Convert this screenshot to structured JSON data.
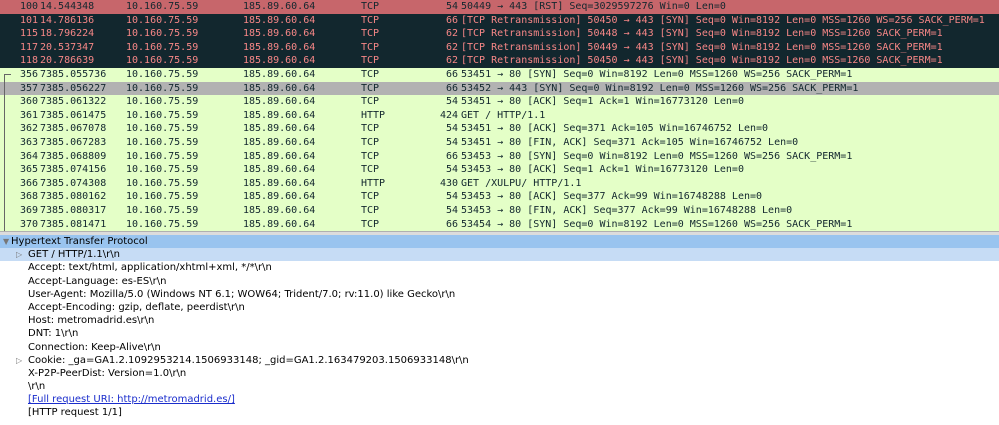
{
  "packets": [
    {
      "no": "100",
      "time": "14.544348",
      "src": "10.160.75.59",
      "dst": "185.89.60.64",
      "proto": "TCP",
      "len": "54",
      "info": "50449 → 443 [RST] Seq=3029597276 Win=0 Len=0",
      "style": "rst-top"
    },
    {
      "no": "101",
      "time": "14.786136",
      "src": "10.160.75.59",
      "dst": "185.89.60.64",
      "proto": "TCP",
      "len": "66",
      "info": "[TCP Retransmission] 50450 → 443 [SYN] Seq=0 Win=8192 Len=0 MSS=1260 WS=256 SACK_PERM=1",
      "style": "retrans"
    },
    {
      "no": "115",
      "time": "18.796224",
      "src": "10.160.75.59",
      "dst": "185.89.60.64",
      "proto": "TCP",
      "len": "62",
      "info": "[TCP Retransmission] 50448 → 443 [SYN] Seq=0 Win=8192 Len=0 MSS=1260 SACK_PERM=1",
      "style": "retrans"
    },
    {
      "no": "117",
      "time": "20.537347",
      "src": "10.160.75.59",
      "dst": "185.89.60.64",
      "proto": "TCP",
      "len": "62",
      "info": "[TCP Retransmission] 50449 → 443 [SYN] Seq=0 Win=8192 Len=0 MSS=1260 SACK_PERM=1",
      "style": "retrans"
    },
    {
      "no": "118",
      "time": "20.786639",
      "src": "10.160.75.59",
      "dst": "185.89.60.64",
      "proto": "TCP",
      "len": "62",
      "info": "[TCP Retransmission] 50450 → 443 [SYN] Seq=0 Win=8192 Len=0 MSS=1260 SACK_PERM=1",
      "style": "retrans"
    },
    {
      "no": "356",
      "time": "7385.055736",
      "src": "10.160.75.59",
      "dst": "185.89.60.64",
      "proto": "TCP",
      "len": "66",
      "info": "53451 → 80 [SYN] Seq=0 Win=8192 Len=0 MSS=1260 WS=256 SACK_PERM=1",
      "style": "tcp",
      "bracket": "first"
    },
    {
      "no": "357",
      "time": "7385.056227",
      "src": "10.160.75.59",
      "dst": "185.89.60.64",
      "proto": "TCP",
      "len": "66",
      "info": "53452 → 443 [SYN] Seq=0 Win=8192 Len=0 MSS=1260 WS=256 SACK_PERM=1",
      "style": "selected",
      "bracket": "mid"
    },
    {
      "no": "360",
      "time": "7385.061322",
      "src": "10.160.75.59",
      "dst": "185.89.60.64",
      "proto": "TCP",
      "len": "54",
      "info": "53451 → 80 [ACK] Seq=1 Ack=1 Win=16773120 Len=0",
      "style": "tcp",
      "bracket": "mid"
    },
    {
      "no": "361",
      "time": "7385.061475",
      "src": "10.160.75.59",
      "dst": "185.89.60.64",
      "proto": "HTTP",
      "len": "424",
      "info": "GET / HTTP/1.1",
      "style": "http",
      "bracket": "mid"
    },
    {
      "no": "362",
      "time": "7385.067078",
      "src": "10.160.75.59",
      "dst": "185.89.60.64",
      "proto": "TCP",
      "len": "54",
      "info": "53451 → 80 [ACK] Seq=371 Ack=105 Win=16746752 Len=0",
      "style": "tcp",
      "bracket": "mid"
    },
    {
      "no": "363",
      "time": "7385.067283",
      "src": "10.160.75.59",
      "dst": "185.89.60.64",
      "proto": "TCP",
      "len": "54",
      "info": "53451 → 80 [FIN, ACK] Seq=371 Ack=105 Win=16746752 Len=0",
      "style": "tcp",
      "bracket": "mid"
    },
    {
      "no": "364",
      "time": "7385.068809",
      "src": "10.160.75.59",
      "dst": "185.89.60.64",
      "proto": "TCP",
      "len": "66",
      "info": "53453 → 80 [SYN] Seq=0 Win=8192 Len=0 MSS=1260 WS=256 SACK_PERM=1",
      "style": "tcp",
      "bracket": "mid"
    },
    {
      "no": "365",
      "time": "7385.074156",
      "src": "10.160.75.59",
      "dst": "185.89.60.64",
      "proto": "TCP",
      "len": "54",
      "info": "53453 → 80 [ACK] Seq=1 Ack=1 Win=16773120 Len=0",
      "style": "tcp",
      "bracket": "mid"
    },
    {
      "no": "366",
      "time": "7385.074308",
      "src": "10.160.75.59",
      "dst": "185.89.60.64",
      "proto": "HTTP",
      "len": "430",
      "info": "GET /XULPU/ HTTP/1.1",
      "style": "http",
      "bracket": "mid"
    },
    {
      "no": "368",
      "time": "7385.080162",
      "src": "10.160.75.59",
      "dst": "185.89.60.64",
      "proto": "TCP",
      "len": "54",
      "info": "53453 → 80 [ACK] Seq=377 Ack=99 Win=16748288 Len=0",
      "style": "tcp",
      "bracket": "mid"
    },
    {
      "no": "369",
      "time": "7385.080317",
      "src": "10.160.75.59",
      "dst": "185.89.60.64",
      "proto": "TCP",
      "len": "54",
      "info": "53453 → 80 [FIN, ACK] Seq=377 Ack=99 Win=16748288 Len=0",
      "style": "tcp",
      "bracket": "mid"
    },
    {
      "no": "370",
      "time": "7385.081471",
      "src": "10.160.75.59",
      "dst": "185.89.60.64",
      "proto": "TCP",
      "len": "66",
      "info": "53454 → 80 [SYN] Seq=0 Win=8192 Len=0 MSS=1260 WS=256 SACK_PERM=1",
      "style": "tcp",
      "bracket": "mid"
    }
  ],
  "details": [
    {
      "text": "Hypertext Transfer Protocol",
      "level": 0,
      "expander": "▼",
      "style": "header",
      "name": "protocol-header"
    },
    {
      "text": "GET / HTTP/1.1\\r\\n",
      "level": 1,
      "expander": "▷",
      "style": "sel-sub",
      "name": "request-line"
    },
    {
      "text": "Accept: text/html, application/xhtml+xml, */*\\r\\n",
      "level": 1
    },
    {
      "text": "Accept-Language: es-ES\\r\\n",
      "level": 1
    },
    {
      "text": "User-Agent: Mozilla/5.0 (Windows NT 6.1; WOW64; Trident/7.0; rv:11.0) like Gecko\\r\\n",
      "level": 1
    },
    {
      "text": "Accept-Encoding: gzip, deflate, peerdist\\r\\n",
      "level": 1
    },
    {
      "text": "Host: metromadrid.es\\r\\n",
      "level": 1
    },
    {
      "text": "DNT: 1\\r\\n",
      "level": 1
    },
    {
      "text": "Connection: Keep-Alive\\r\\n",
      "level": 1
    },
    {
      "text": "Cookie: _ga=GA1.2.1092953214.1506933148; _gid=GA1.2.163479203.1506933148\\r\\n",
      "level": 1,
      "expander": "▷"
    },
    {
      "text": "X-P2P-PeerDist: Version=1.0\\r\\n",
      "level": 1
    },
    {
      "text": "\\r\\n",
      "level": 1
    },
    {
      "text": "[Full request URI: http://metromadrid.es/]",
      "level": 1,
      "style": "link"
    },
    {
      "text": "[HTTP request 1/1]",
      "level": 1
    }
  ],
  "colors": {
    "rst_background": "#c7666b",
    "retransmission_background": "#12272e",
    "retransmission_text": "#f78787",
    "tcp_background": "#e4ffc7",
    "selected_background": "#b2b2b2",
    "detail_header_background": "#99c4ef"
  }
}
